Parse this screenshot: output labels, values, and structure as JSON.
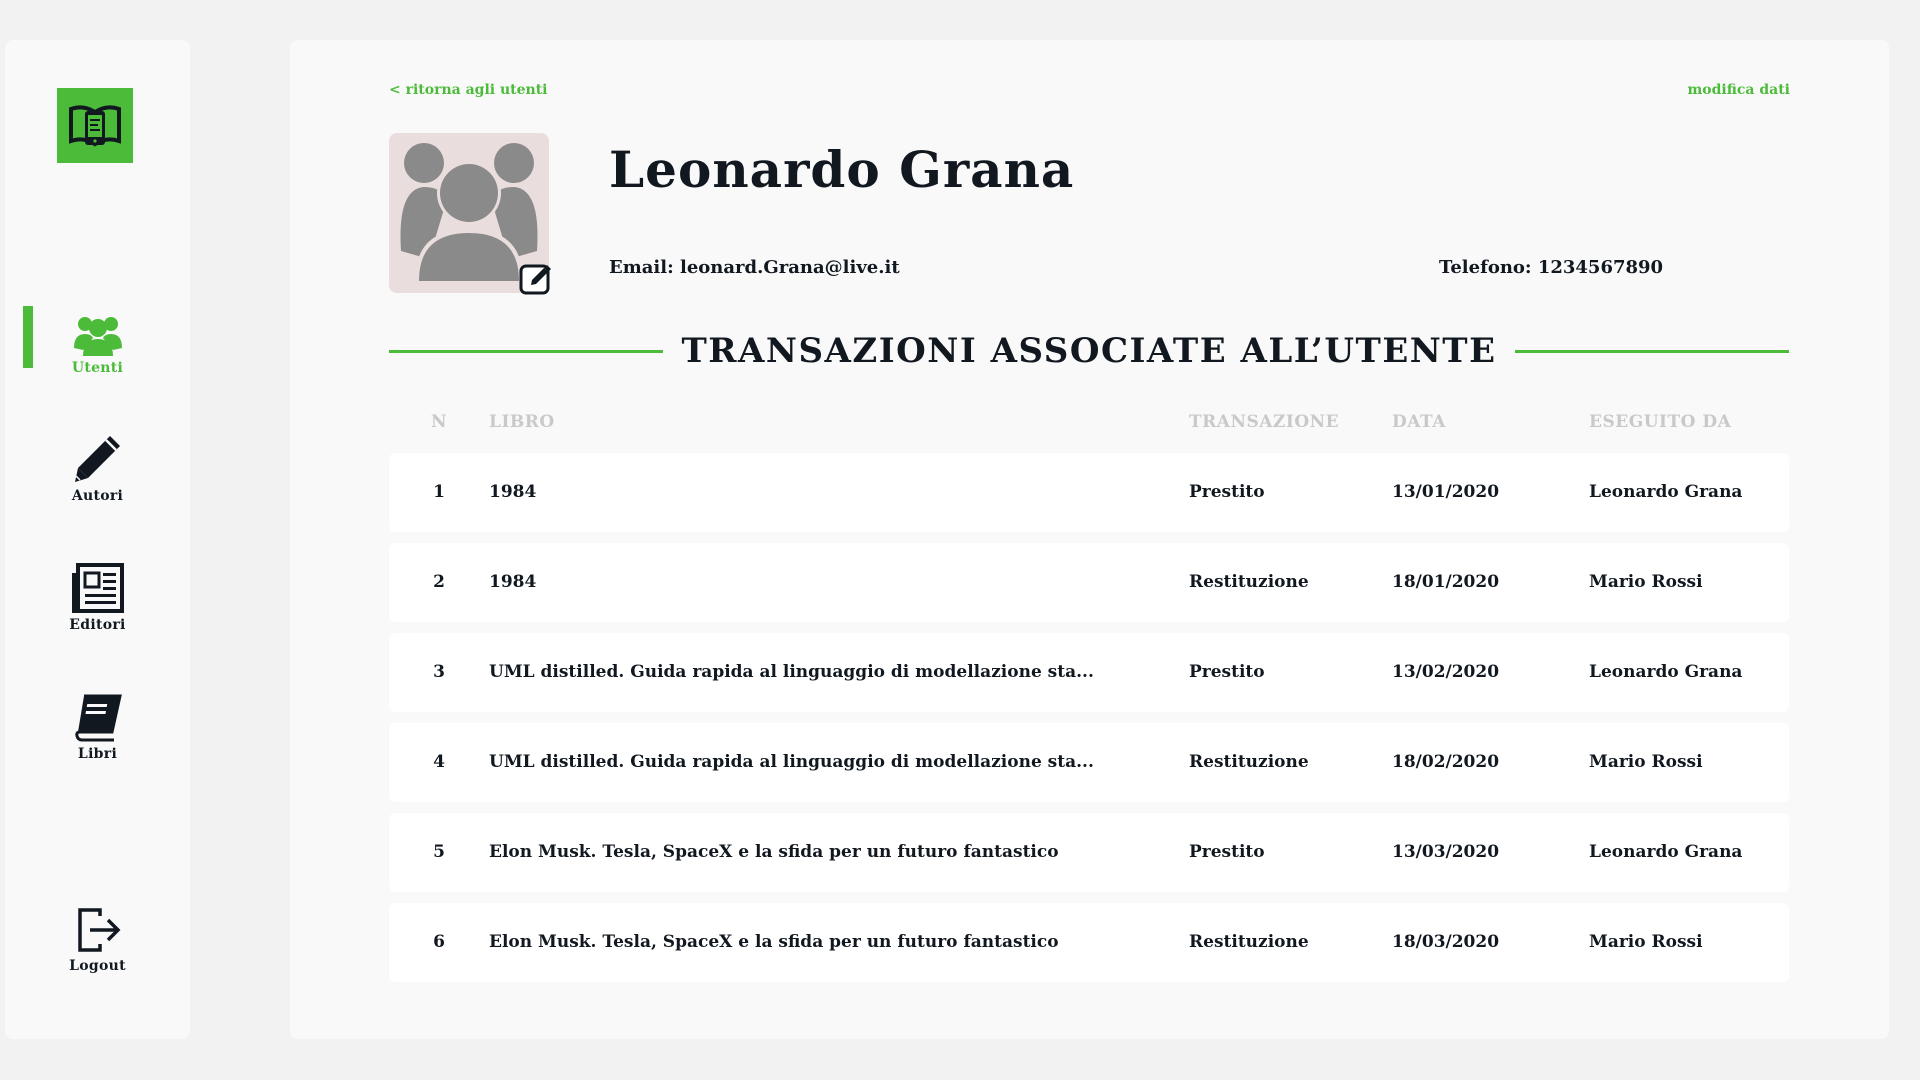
{
  "sidebar": {
    "logo_icon": "book-phone-icon",
    "items": [
      {
        "label": "Utenti",
        "icon": "users-icon",
        "active": true
      },
      {
        "label": "Autori",
        "icon": "pencil-icon",
        "active": false
      },
      {
        "label": "Editori",
        "icon": "newspaper-icon",
        "active": false
      },
      {
        "label": "Libri",
        "icon": "book-icon",
        "active": false
      }
    ],
    "logout": {
      "label": "Logout",
      "icon": "logout-icon"
    }
  },
  "header": {
    "back_link": "< ritorna agli utenti",
    "edit_link": "modifica dati"
  },
  "user": {
    "name": "Leonardo Grana",
    "email": "Email: leonard.Grana@live.it",
    "phone": "Telefono: 1234567890"
  },
  "section": {
    "title": "TRANSAZIONI ASSOCIATE ALL’UTENTE"
  },
  "table": {
    "headers": {
      "n": "N",
      "libro": "LIBRO",
      "transazione": "TRANSAZIONE",
      "data": "DATA",
      "eseguito": "ESEGUITO DA"
    },
    "rows": [
      {
        "n": "1",
        "libro": "1984",
        "transazione": "Prestito",
        "data": "13/01/2020",
        "eseguito": "Leonardo Grana"
      },
      {
        "n": "2",
        "libro": "1984",
        "transazione": "Restituzione",
        "data": "18/01/2020",
        "eseguito": "Mario Rossi"
      },
      {
        "n": "3",
        "libro": "UML distilled. Guida rapida al linguaggio di modellazione sta...",
        "transazione": "Prestito",
        "data": "13/02/2020",
        "eseguito": "Leonardo Grana"
      },
      {
        "n": "4",
        "libro": "UML distilled. Guida rapida al linguaggio di modellazione sta...",
        "transazione": "Restituzione",
        "data": "18/02/2020",
        "eseguito": "Mario Rossi"
      },
      {
        "n": "5",
        "libro": "Elon Musk. Tesla, SpaceX e la sfida per un futuro fantastico",
        "transazione": "Prestito",
        "data": "13/03/2020",
        "eseguito": "Leonardo Grana"
      },
      {
        "n": "6",
        "libro": "Elon Musk. Tesla, SpaceX e la sfida per un futuro fantastico",
        "transazione": "Restituzione",
        "data": "18/03/2020",
        "eseguito": "Mario Rossi"
      }
    ]
  },
  "colors": {
    "accent": "#4cbb3a",
    "text": "#111820",
    "muted": "#c9c9c9",
    "avatar_bg": "#e9dedd"
  }
}
